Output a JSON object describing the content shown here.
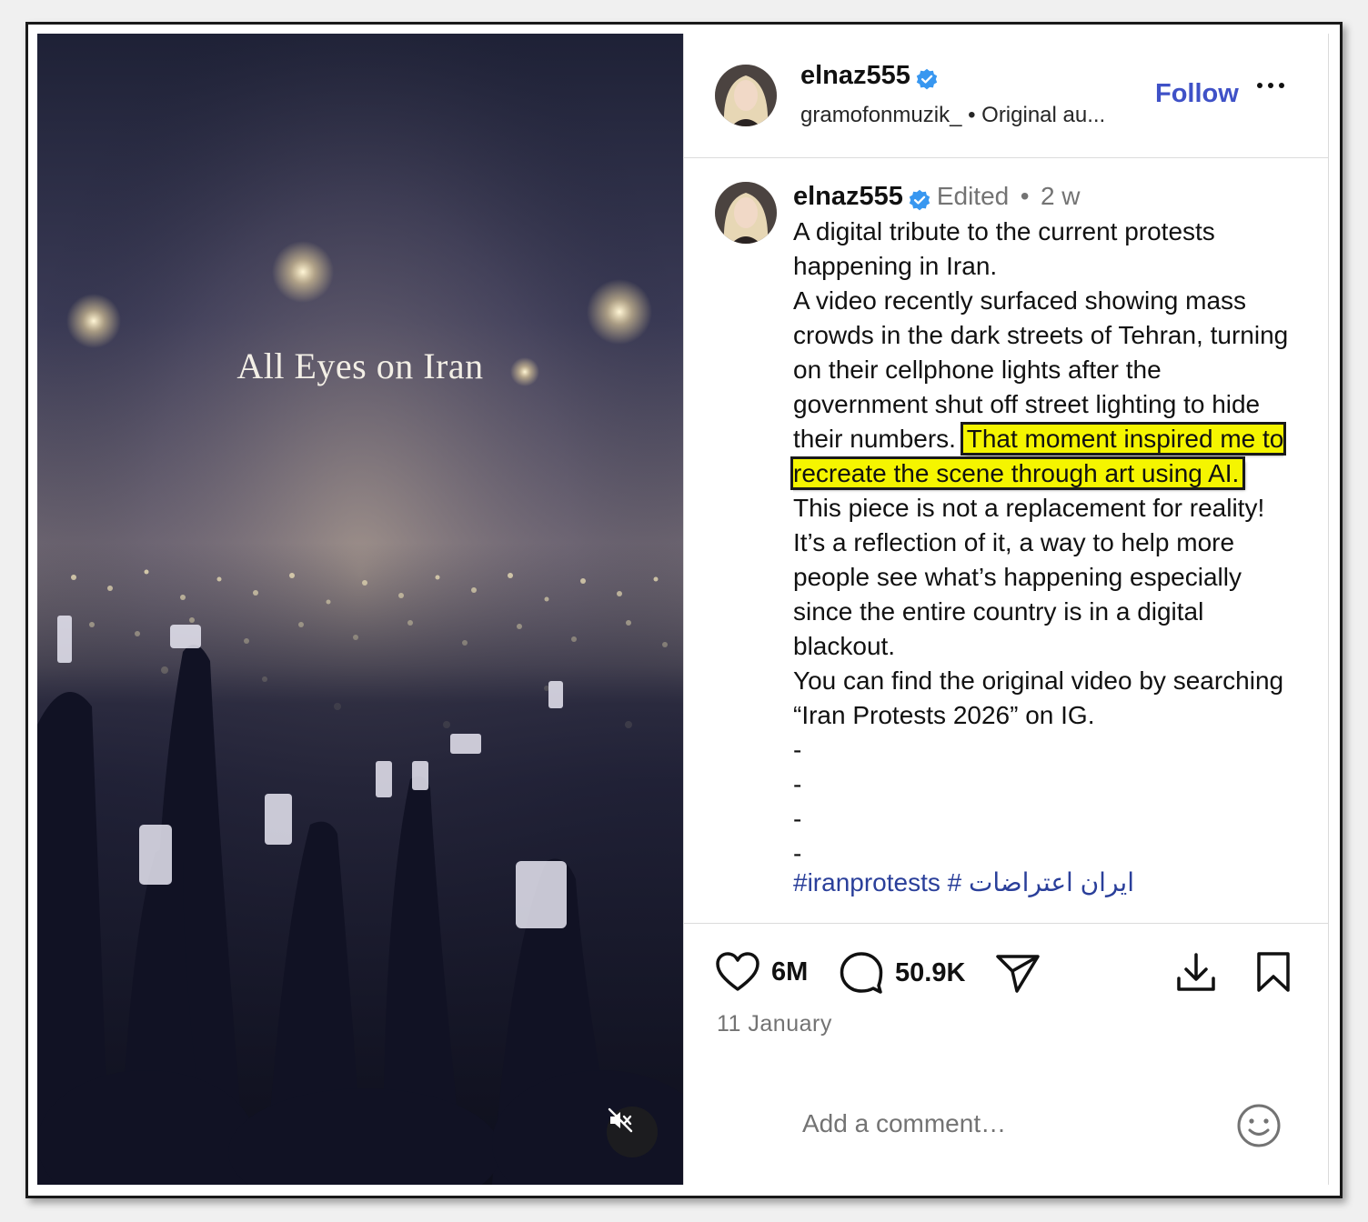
{
  "media": {
    "overlay_title": "All Eyes on Iran",
    "mute_icon": "speaker-muted-icon"
  },
  "header": {
    "username": "elnaz555",
    "audio_line": "gramofonmuzik_ • Original au...",
    "follow_label": "Follow",
    "more_icon": "more-horizontal-icon"
  },
  "caption": {
    "username": "elnaz555",
    "edited": "Edited",
    "separator": "•",
    "age": "2 w",
    "p1": "A digital tribute to the current protests happening in Iran.",
    "p2_before": "A video recently surfaced showing mass crowds in the dark streets of Tehran, turning on their cellphone lights after the government shut off street lighting to hide their numbers.",
    "p2_highlight": "That moment inspired me to recreate the scene through art using AI.",
    "p3": "This piece is not a replacement for reality! It’s a reflection of it, a way to help more people see what’s happening especially since the entire country is in a digital blackout.",
    "p4": "You can find the original video by searching “Iran Protests 2026” on IG.",
    "dash1": "-",
    "dash2": "-",
    "dash3": "-",
    "dash4": "-",
    "hashtags": "#iranprotests # ايران اعتراضات"
  },
  "actions": {
    "likes": "6M",
    "comments": "50.9K",
    "date": "11 January",
    "comment_placeholder": "Add a comment…"
  },
  "colors": {
    "follow_blue": "#3f51c7",
    "verified_blue": "#3897f0",
    "highlight_yellow": "#f5f500",
    "muted_text": "#737373"
  }
}
